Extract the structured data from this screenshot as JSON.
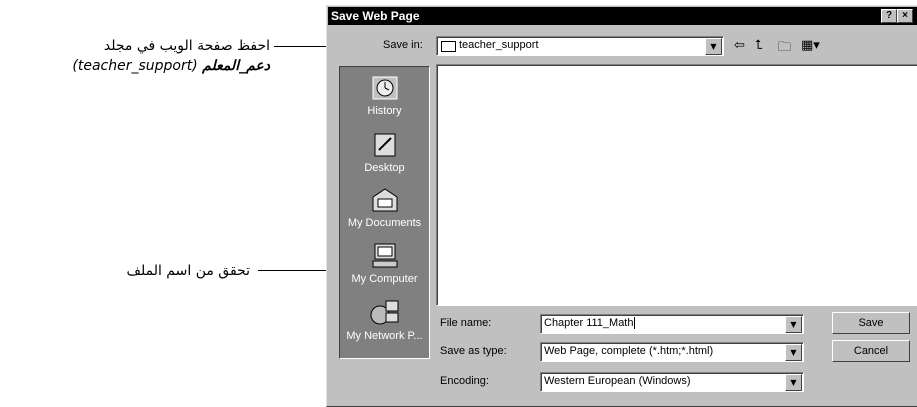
{
  "annotations": {
    "save_in_line1": "احفظ صفحة الويب في مجلد",
    "save_in_line2_ar": "دعم_المعلم",
    "save_in_line2_en": "(teacher_support)",
    "check_filename": "تحقق من اسم الملف"
  },
  "dialog": {
    "title": "Save Web Page",
    "help_button": "?",
    "close_button": "×",
    "save_in": {
      "label": "Save in:",
      "value": "teacher_support"
    },
    "toolbar": {
      "back_icon": "back-arrow-icon",
      "up_icon": "up-folder-icon",
      "new_folder_icon": "new-folder-icon",
      "views_icon": "views-menu-icon"
    },
    "places": [
      {
        "label": "History",
        "icon": "history-icon"
      },
      {
        "label": "Desktop",
        "icon": "desktop-icon"
      },
      {
        "label": "My Documents",
        "icon": "my-documents-icon"
      },
      {
        "label": "My Computer",
        "icon": "my-computer-icon"
      },
      {
        "label": "My Network P...",
        "icon": "my-network-places-icon"
      }
    ],
    "file_name": {
      "label": "File name:",
      "value": "Chapter 111_Math"
    },
    "save_as_type": {
      "label": "Save as type:",
      "value": "Web Page, complete (*.htm;*.html)"
    },
    "encoding": {
      "label": "Encoding:",
      "value": "Western European (Windows)"
    },
    "save_button": "Save",
    "cancel_button": "Cancel"
  }
}
